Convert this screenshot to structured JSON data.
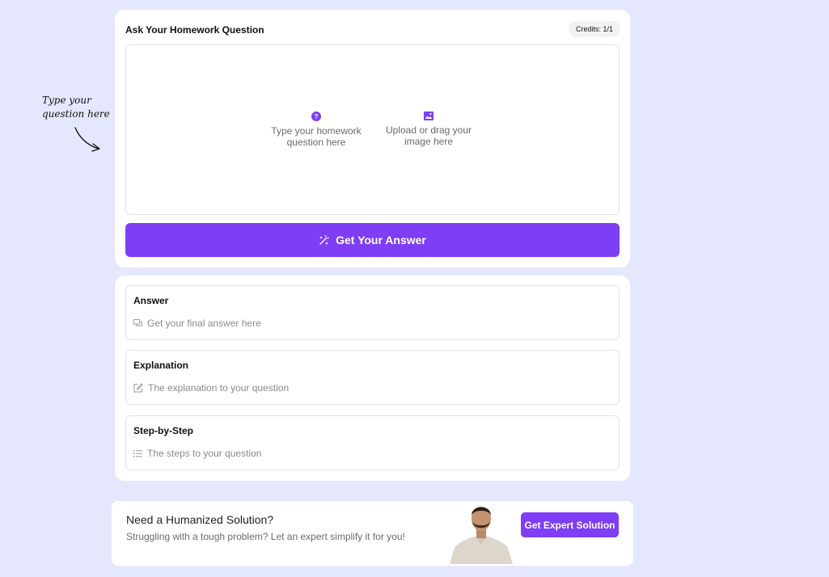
{
  "hint": {
    "line1": "Type your",
    "line2": "question here"
  },
  "ask": {
    "title": "Ask Your Homework Question",
    "credits": "Credits: 1/1",
    "type_option": {
      "line1": "Type your homework",
      "line2": "question here",
      "icon": "question-circle-icon"
    },
    "upload_option": {
      "line1": "Upload or drag your",
      "line2": "image here",
      "icon": "image-icon"
    },
    "submit_label": "Get Your Answer",
    "submit_icon": "magic-wand-icon"
  },
  "results": {
    "answer": {
      "title": "Answer",
      "placeholder": "Get your final answer here",
      "icon": "chat-icon"
    },
    "explanation": {
      "title": "Explanation",
      "placeholder": "The explanation to your question",
      "icon": "edit-icon"
    },
    "steps": {
      "title": "Step-by-Step",
      "placeholder": "The steps to your question",
      "icon": "list-icon"
    }
  },
  "expert": {
    "title": "Need a Humanized Solution?",
    "description": "Struggling with a tough problem? Let an expert simplify it for you!",
    "button_label": "Get Expert Solution"
  },
  "colors": {
    "accent": "#7e3ef5",
    "background": "#e5e8fd"
  }
}
